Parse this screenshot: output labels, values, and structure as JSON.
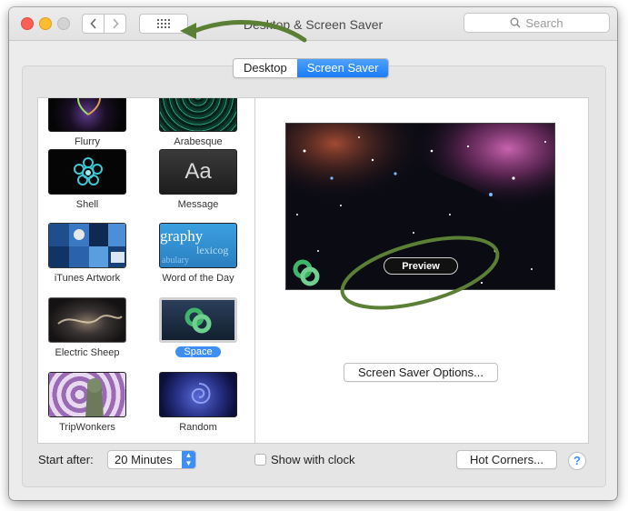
{
  "window": {
    "title": "Desktop & Screen Saver"
  },
  "search": {
    "placeholder": "Search"
  },
  "tabs": [
    {
      "label": "Desktop",
      "active": false
    },
    {
      "label": "Screen Saver",
      "active": true
    }
  ],
  "savers": [
    {
      "label": "Flurry"
    },
    {
      "label": "Arabesque"
    },
    {
      "label": "Shell"
    },
    {
      "label": "Message",
      "thumb_text": "Aa"
    },
    {
      "label": "iTunes Artwork"
    },
    {
      "label": "Word of the Day",
      "thumb_words": [
        "graphy",
        "lexicog",
        "abulary"
      ]
    },
    {
      "label": "Electric Sheep"
    },
    {
      "label": "Space",
      "selected": true
    },
    {
      "label": "TripWonkers"
    },
    {
      "label": "Random"
    }
  ],
  "preview": {
    "badge": "Preview"
  },
  "options_button": {
    "label": "Screen Saver Options..."
  },
  "bottom": {
    "start_after_label": "Start after:",
    "start_after_value": "20 Minutes",
    "show_clock_label": "Show with clock",
    "show_clock_checked": false,
    "hot_corners_label": "Hot Corners...",
    "help_label": "?"
  },
  "colors": {
    "accent": "#3d8ef7",
    "annotation": "#5a7f35"
  }
}
